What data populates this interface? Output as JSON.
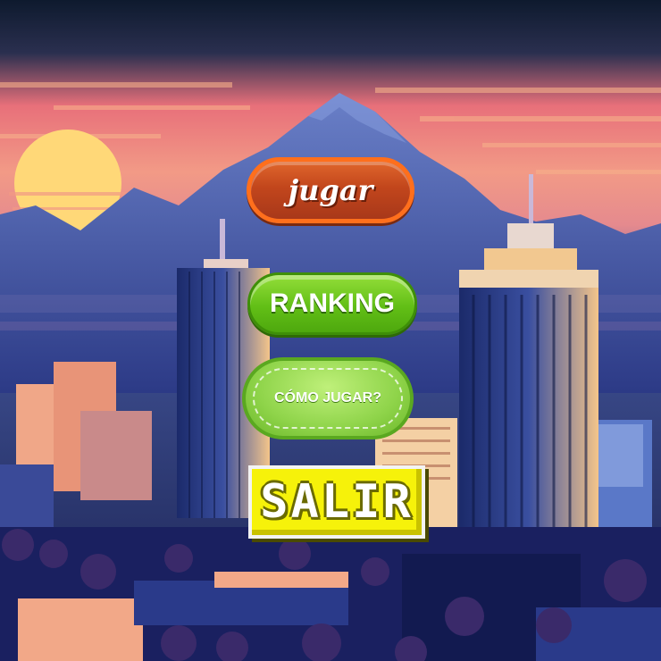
{
  "menu": {
    "play_label": "jugar",
    "ranking_label": "RANKING",
    "how_to_play_label": "CÓMO JUGAR?",
    "exit_label": "SALIR"
  },
  "colors": {
    "play_button": "#c2461c",
    "ranking_button": "#62bf16",
    "how_to_play_button": "#8fd44a",
    "exit_button": "#f6f20a"
  }
}
